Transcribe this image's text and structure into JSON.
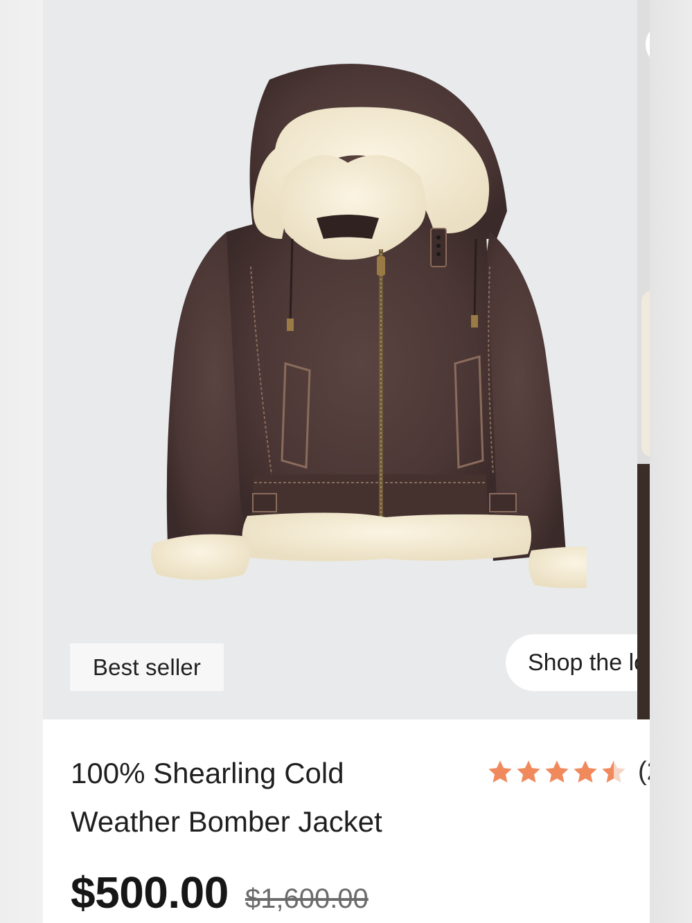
{
  "product": {
    "badge": "Best seller",
    "shop_the_look": "Shop the lo",
    "title_line1": "100% Shearling Cold",
    "title_line2": "Weather Bomber Jacket",
    "rating": 4.5,
    "rating_count": "(2",
    "price": "$500.00",
    "original_price": "$1,600.00"
  },
  "colors": {
    "star": "#f08a5d",
    "leather": "#4a3634",
    "shearling": "#f3ead2",
    "image_bg": "#e9eaec"
  },
  "icons": {
    "rating": "star-icon"
  }
}
